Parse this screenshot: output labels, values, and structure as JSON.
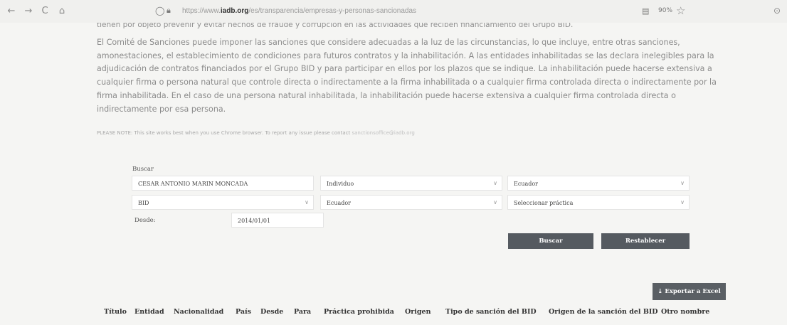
{
  "browser": {
    "url_prefix": "https://www.",
    "url_domain": "iadb.org",
    "url_path": "/es/transparencia/empresas-y-personas-sancionadas",
    "zoom": "90%"
  },
  "page": {
    "cut_line": "tienen por objeto prevenir y evitar hechos de fraude y corrupción en las actividades que reciben financiamiento del Grupo BID.",
    "paragraph": "El Comité de Sanciones puede imponer las sanciones que considere adecuadas a la luz de las circunstancias, lo que incluye, entre otras sanciones, amonestaciones, el establecimiento de condiciones para futuros contratos y la inhabilitación. A las entidades inhabilitadas se las declara inelegibles para la adjudicación de contratos financiados por el Grupo BID y para participar en ellos por los plazos que se indique. La inhabilitación puede hacerse extensiva a cualquier firma o persona natural que controle directa o indirectamente a la firma inhabilitada o a cualquier firma controlada directa o indirectamente por la firma inhabilitada. En el caso de una persona natural inhabilitada, la inhabilitación puede hacerse extensiva a cualquier firma controlada directa o indirectamente por esa persona.",
    "note": "PLEASE NOTE: This site works best when you use Chrome browser. To report any issue please contact ",
    "note_email": "sanctionsoffice@iadb.org"
  },
  "search": {
    "label": "Buscar",
    "name_value": "CESAR ANTONIO MARIN MONCADA",
    "type_value": "Individuo",
    "country_value": "Ecuador",
    "entity_value": "BID",
    "nationality_value": "Ecuador",
    "practice_value": "Seleccionar práctica",
    "desde_label": "Desde:",
    "desde_value": "2014/01/01",
    "buscar_button": "Buscar",
    "reset_button": "Restablecer",
    "export_button": "Exportar a Excel"
  },
  "table": {
    "headers": [
      "Título",
      "Entidad",
      "Nacionalidad",
      "País",
      "Desde",
      "Para",
      "Práctica prohibida",
      "Origen",
      "Tipo de sanción del BID",
      "Origen de la sanción del BID",
      "Otro nombre"
    ]
  }
}
